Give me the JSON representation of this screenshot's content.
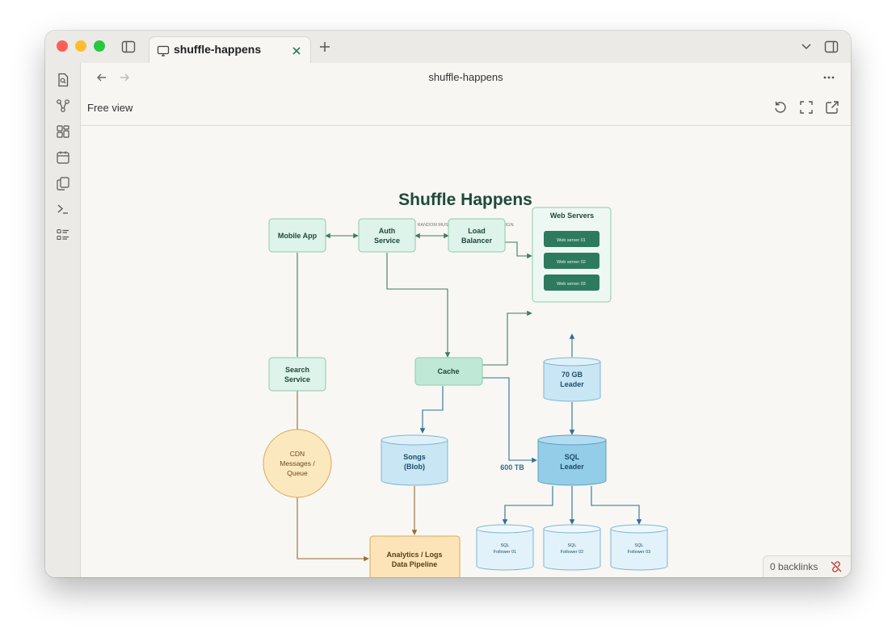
{
  "window": {
    "tab_title": "shuffle-happens",
    "note_title": "shuffle-happens",
    "view_mode": "Free view",
    "backlinks": "0 backlinks"
  },
  "diagram": {
    "title": "Shuffle Happens",
    "subtitle": "RANDOM MUSIC SERVICE / SYSTEM DESIGN",
    "nodes": {
      "mobile_app": "Mobile App",
      "auth_service": [
        "Auth",
        "Service"
      ],
      "load_balancer": [
        "Load",
        "Balancer"
      ],
      "web_servers_title": "Web Servers",
      "web_server_01": "Web server 01",
      "web_server_02": "Web server 02",
      "web_server_03": "Web server 03",
      "search_service": [
        "Search",
        "Service"
      ],
      "cache": "Cache",
      "leader_70gb": [
        "70 GB",
        "Leader"
      ],
      "cdn": [
        "CDN",
        "Messages /",
        "Queue"
      ],
      "songs": [
        "Songs",
        "(Blob)"
      ],
      "sql_leader": [
        "SQL",
        "Leader"
      ],
      "edge_label_600tb": "600 TB",
      "analytics": [
        "Analytics / Logs",
        "Data Pipeline"
      ],
      "sql_follower_01": [
        "SQL",
        "Follower 01"
      ],
      "sql_follower_02": [
        "SQL",
        "Follower 02"
      ],
      "sql_follower_03": [
        "SQL",
        "Follower 03"
      ]
    }
  },
  "colors": {
    "dark_green": "#1d4a3a",
    "mint_fill": "#def3e9",
    "mint_stroke": "#8fc9ad",
    "cache_fill": "#bfe8d6",
    "server_fill": "#2e7a5e",
    "blue_fill": "#c9e6f4",
    "blue_stroke": "#7fb5d1",
    "sql_leader_fill": "#94cde8",
    "light_blue_fill": "#e2f2fa",
    "cdn_fill": "#fbe8be",
    "analytics_fill": "#fde4b8",
    "orange_stroke": "#d9a95a",
    "arrow_green": "#3d7d63",
    "arrow_blue": "#2f6f94",
    "arrow_brown": "#9a6a35"
  },
  "icons": [
    "sidebar-toggle-icon",
    "monitor-icon",
    "close-icon",
    "plus-icon",
    "chevron-down-icon",
    "right-sidebar-icon",
    "file-search-icon",
    "graph-icon",
    "canvas-icon",
    "calendar-icon",
    "copy-icon",
    "terminal-icon",
    "list-icon",
    "back-arrow-icon",
    "forward-arrow-icon",
    "more-icon",
    "reset-icon",
    "fullscreen-icon",
    "open-external-icon",
    "unlinked-icon"
  ]
}
